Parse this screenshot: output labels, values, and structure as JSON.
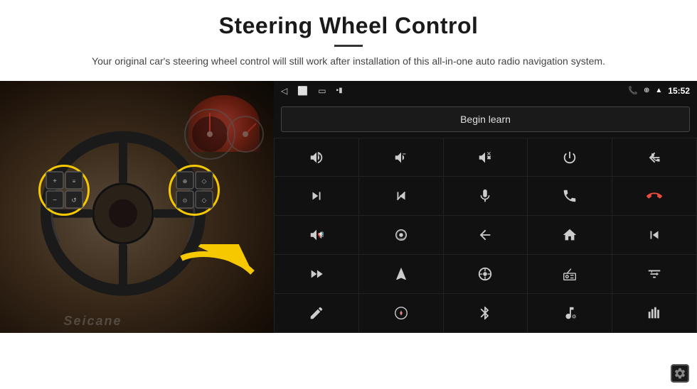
{
  "header": {
    "title": "Steering Wheel Control",
    "subtitle": "Your original car's steering wheel control will still work after installation of this all-in-one auto radio navigation system."
  },
  "android_unit": {
    "status_bar": {
      "back_icon": "◁",
      "home_icon": "⬜",
      "recents_icon": "▭",
      "battery_icon": "🔋",
      "phone_icon": "📞",
      "location_icon": "⊕",
      "wifi_icon": "▲",
      "time": "15:52"
    },
    "begin_learn_label": "Begin learn",
    "seicane_watermark": "Seicane"
  }
}
